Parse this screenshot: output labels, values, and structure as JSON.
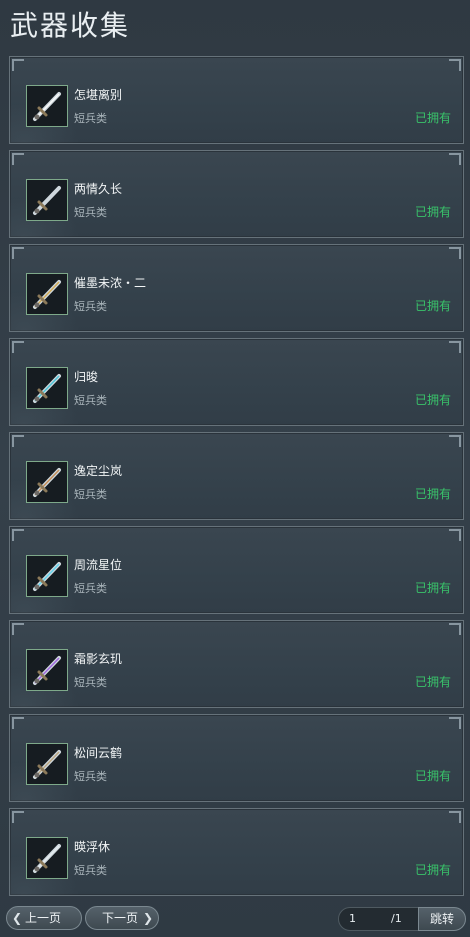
{
  "header": {
    "title": "武器收集"
  },
  "accent": {
    "owned_color": "#39c36a"
  },
  "items": [
    {
      "name": "怎堪离别",
      "type": "短兵类",
      "status": "已拥有",
      "icon": "sword-icon",
      "glow": "#ffffff"
    },
    {
      "name": "两情久长",
      "type": "短兵类",
      "status": "已拥有",
      "icon": "sword-icon",
      "glow": "#cfd6dc"
    },
    {
      "name": "催墨未浓・二",
      "type": "短兵类",
      "status": "已拥有",
      "icon": "sword-icon",
      "glow": "#d4a84b"
    },
    {
      "name": "归晙",
      "type": "短兵类",
      "status": "已拥有",
      "icon": "sword-icon",
      "glow": "#3fc3d8"
    },
    {
      "name": "逸定尘岚",
      "type": "短兵类",
      "status": "已拥有",
      "icon": "sword-icon",
      "glow": "#c4874a"
    },
    {
      "name": "周流星位",
      "type": "短兵类",
      "status": "已拥有",
      "icon": "sword-icon",
      "glow": "#57d4f0"
    },
    {
      "name": "霜影玄玑",
      "type": "短兵类",
      "status": "已拥有",
      "icon": "sword-icon",
      "glow": "#9b5ce0"
    },
    {
      "name": "松间云鹤",
      "type": "短兵类",
      "status": "已拥有",
      "icon": "sword-icon",
      "glow": "#b9a27a"
    },
    {
      "name": "暎浮休",
      "type": "短兵类",
      "status": "已拥有",
      "icon": "sword-icon",
      "glow": "#e6eef2"
    }
  ],
  "pager": {
    "prev_label": "上一页",
    "next_label": "下一页",
    "current_page": "1",
    "total_label": "/1",
    "jump_label": "跳转"
  }
}
